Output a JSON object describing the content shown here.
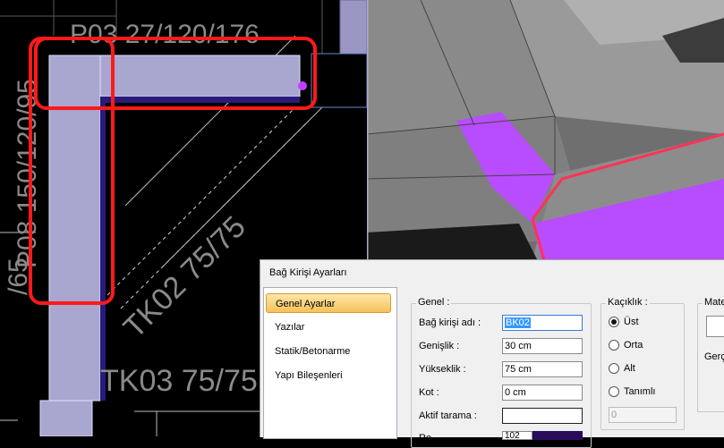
{
  "cad": {
    "label_top": "P03 27/120/176",
    "label_left_a": "P08 150/120/95",
    "label_left_b": "/65",
    "label_diag": "TK02 75/75",
    "label_bottom": "TK03 75/75"
  },
  "dialog": {
    "title": "Bağ Kirişi Ayarları",
    "nav": [
      "Genel Ayarlar",
      "Yazılar",
      "Statik/Betonarme",
      "Yapı Bileşenleri"
    ],
    "genel": {
      "heading": "Genel :",
      "fields": [
        {
          "label": "Bağ kirişi adı :",
          "value": "BK02"
        },
        {
          "label": "Genişlik :",
          "value": "30 cm"
        },
        {
          "label": "Yükseklik :",
          "value": "75 cm"
        },
        {
          "label": "Kot :",
          "value": "0 cm"
        },
        {
          "label": "Aktif tarama :",
          "value": ""
        }
      ],
      "partial_label": "Re",
      "partial_value": "102"
    },
    "kacik": {
      "heading": "Kaçıklık :",
      "options": [
        "Üst",
        "Orta",
        "Alt",
        "Tanımlı"
      ],
      "selected": "Üst",
      "value": "0"
    },
    "mate": {
      "heading": "Mate",
      "label": "Gerç"
    }
  },
  "colors": {
    "highlight_red": "#ff1a1a",
    "beam_fill": "#a9a6cf",
    "magenta": "#b84dff",
    "accent_nav": "#f6c25a"
  }
}
